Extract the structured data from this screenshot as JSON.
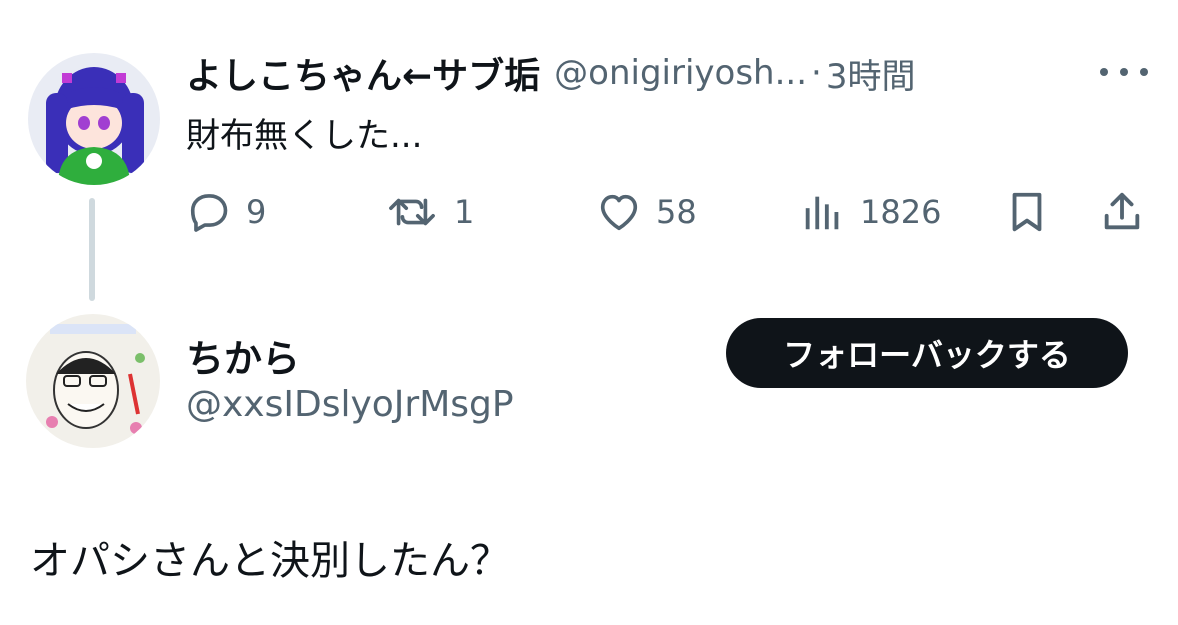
{
  "tweet1": {
    "display_name": "よしこちゃん←サブ垢",
    "handle": "@onigiriyosh...",
    "separator": "·",
    "time": "3時間",
    "text": "財布無くした...",
    "actions": {
      "reply_count": "9",
      "retweet_count": "1",
      "like_count": "58",
      "view_count": "1826"
    }
  },
  "tweet2": {
    "display_name": "ちから",
    "handle": "@xxsIDslyoJrMsgP",
    "follow_button_label": "フォローバックする",
    "text": "オパシさんと決別したん？"
  },
  "icons": [
    "more-icon",
    "reply-icon",
    "retweet-icon",
    "like-icon",
    "views-icon",
    "bookmark-icon",
    "share-icon"
  ],
  "colors": {
    "text": "#0f1419",
    "secondary": "#536471",
    "thread_line": "#cfd9de",
    "button_bg": "#0f1419",
    "button_text": "#ffffff"
  }
}
